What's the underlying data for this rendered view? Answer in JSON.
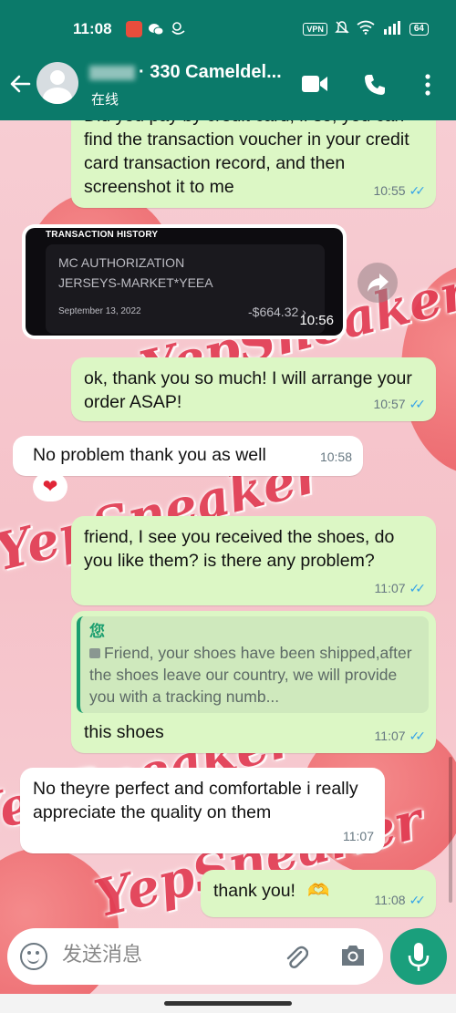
{
  "status_bar": {
    "time": "11:08",
    "vpn_label": "VPN",
    "battery": "64"
  },
  "header": {
    "contact_name": "· 330 Cameldel...",
    "contact_status": "在线"
  },
  "messages": [
    {
      "id": "m1",
      "direction": "outgoing",
      "text": "Did you pay by credit card, if so, you can find the transaction voucher in your credit card transaction record, and then screenshot it to me",
      "time": "10:55",
      "read": true
    },
    {
      "id": "m2",
      "direction": "incoming",
      "type": "image",
      "time": "10:56",
      "image": {
        "heading": "TRANSACTION HISTORY",
        "merchant_line1": "MC AUTHORIZATION",
        "merchant_line2": "JERSEYS-MARKET*YEEA",
        "date": "September 13, 2022",
        "amount": "-$664.32"
      }
    },
    {
      "id": "m3",
      "direction": "outgoing",
      "text": "ok, thank you so much! I will arrange your order ASAP!",
      "time": "10:57",
      "read": true
    },
    {
      "id": "m4",
      "direction": "incoming",
      "text": "No problem thank you as well",
      "time": "10:58",
      "reaction": "❤"
    },
    {
      "id": "m5",
      "direction": "outgoing",
      "text": "friend, I see you received the shoes, do you like them? is there any problem?",
      "time": "11:07",
      "read": true
    },
    {
      "id": "m6",
      "direction": "outgoing",
      "text": "this shoes",
      "time": "11:07",
      "read": true,
      "quote": {
        "author": "您",
        "text": "Friend, your shoes have been shipped,after the shoes leave our country, we will provide you with a tracking numb..."
      }
    },
    {
      "id": "m7",
      "direction": "incoming",
      "text": "No theyre perfect and comfortable i really appreciate the quality on them",
      "time": "11:07"
    },
    {
      "id": "m8",
      "direction": "outgoing",
      "text": "thank you!",
      "emoji": "🫶",
      "time": "11:08",
      "read": true
    }
  ],
  "composer": {
    "placeholder": "发送消息"
  },
  "watermark": "YepSneaker",
  "colors": {
    "header": "#0b7a6a",
    "outgoing_bubble": "#dcf7c5",
    "incoming_bubble": "#ffffff",
    "read_ticks": "#34a3e8",
    "mic_button": "#1a9f7c"
  },
  "icons": [
    "back-arrow-icon",
    "video-call-icon",
    "voice-call-icon",
    "more-options-icon",
    "emoji-icon",
    "attach-icon",
    "camera-icon",
    "mic-icon",
    "forward-icon",
    "photo-icon"
  ]
}
